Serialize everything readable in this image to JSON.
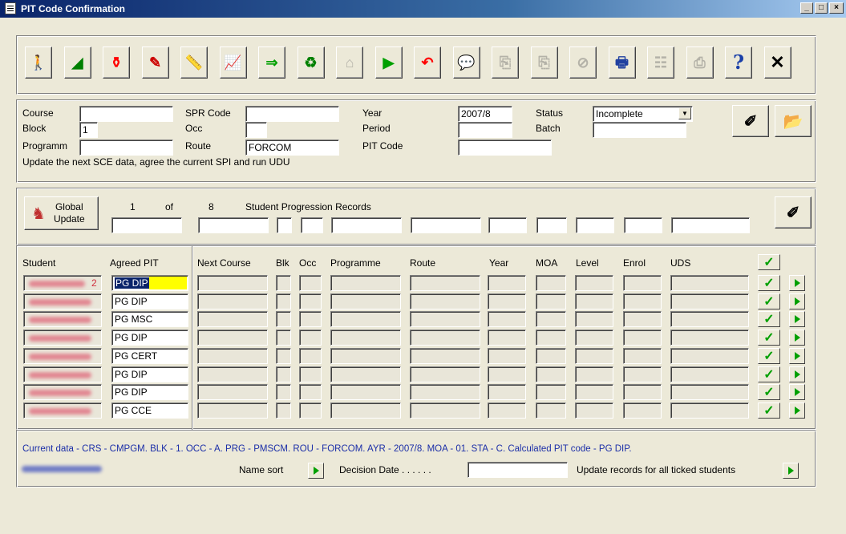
{
  "window": {
    "title": "PIT Code Confirmation",
    "controls": [
      "_",
      "□",
      "×"
    ]
  },
  "toolbar": {
    "buttons": [
      {
        "name": "person-icon",
        "glyph": "🚶",
        "enabled": true
      },
      {
        "name": "eraser-icon",
        "glyph": "◢",
        "enabled": true
      },
      {
        "name": "bottles-icon",
        "glyph": "⚱",
        "enabled": true
      },
      {
        "name": "pencil-icon",
        "glyph": "✎",
        "enabled": true
      },
      {
        "name": "ruler-icon",
        "glyph": "📏",
        "enabled": true
      },
      {
        "name": "presenter-icon",
        "glyph": "📈",
        "enabled": true
      },
      {
        "name": "truck-icon",
        "glyph": "⇒",
        "enabled": true
      },
      {
        "name": "recycle-icon",
        "glyph": "♻",
        "enabled": true
      },
      {
        "name": "puzzle-icon",
        "glyph": "⌂",
        "enabled": false
      },
      {
        "name": "play-icon",
        "glyph": "▶",
        "enabled": true
      },
      {
        "name": "undo-icon",
        "glyph": "↶",
        "enabled": true
      },
      {
        "name": "speech-bubble-icon",
        "glyph": "💬",
        "enabled": true
      },
      {
        "name": "copy-icon",
        "glyph": "⎘",
        "enabled": false
      },
      {
        "name": "copy2-icon",
        "glyph": "⎘",
        "enabled": false
      },
      {
        "name": "no-edit-icon",
        "glyph": "⊘",
        "enabled": false
      },
      {
        "name": "printer-icon",
        "glyph": "🖶",
        "enabled": true
      },
      {
        "name": "stack-icon",
        "glyph": "☷",
        "enabled": false
      },
      {
        "name": "document-icon",
        "glyph": "⎙",
        "enabled": false
      },
      {
        "name": "help-icon",
        "glyph": "?",
        "enabled": true
      },
      {
        "name": "close-icon",
        "glyph": "✕",
        "enabled": true
      }
    ]
  },
  "form": {
    "course_label": "Course",
    "course_value": "",
    "block_label": "Block",
    "block_value": "1",
    "programm_label": "Programm",
    "programm_value": "",
    "spr_label": "SPR Code",
    "spr_value": "",
    "occ_label": "Occ",
    "occ_value": "",
    "route_label": "Route",
    "route_value": "FORCOM",
    "year_label": "Year",
    "year_value": "2007/8",
    "period_label": "Period",
    "period_value": "",
    "pit_label": "PIT Code",
    "pit_value": "",
    "status_label": "Status",
    "status_value": "Incomplete",
    "batch_label": "Batch",
    "batch_value": "",
    "instructions": "Update the next SCE data, agree the current SPI and run UDU"
  },
  "global": {
    "button_line1": "Global",
    "button_line2": "Update",
    "current": "1",
    "of_label": "of",
    "total": "8",
    "records_label": "Student Progression Records"
  },
  "grid": {
    "headers": {
      "student": "Student",
      "agreed_pit": "Agreed PIT",
      "next_course": "Next Course",
      "blk": "Blk",
      "occ": "Occ",
      "programme": "Programme",
      "route": "Route",
      "year": "Year",
      "moa": "MOA",
      "level": "Level",
      "enrol": "Enrol",
      "uds": "UDS"
    },
    "rows": [
      {
        "student_suffix": "2",
        "pit": "PG DIP",
        "selected": true
      },
      {
        "student_suffix": "",
        "pit": "PG DIP",
        "selected": false
      },
      {
        "student_suffix": "",
        "pit": "PG MSC",
        "selected": false
      },
      {
        "student_suffix": "",
        "pit": "PG DIP",
        "selected": false
      },
      {
        "student_suffix": "",
        "pit": "PG CERT",
        "selected": false
      },
      {
        "student_suffix": "",
        "pit": "PG DIP",
        "selected": false
      },
      {
        "student_suffix": "",
        "pit": "PG DIP",
        "selected": false
      },
      {
        "student_suffix": "",
        "pit": "PG CCE",
        "selected": false
      }
    ]
  },
  "footer": {
    "current_data": "Current data - CRS - CMPGM. BLK - 1. OCC - A. PRG - PMSCM. ROU - FORCOM. AYR - 2007/8. MOA - 01. STA - C. Calculated PIT code - PG DIP.",
    "name_sort": "Name sort",
    "decision_date": "Decision Date . . . . . .",
    "decision_value": "",
    "update_all": "Update records for all ticked students"
  },
  "colors": {
    "title_start": "#0a246a",
    "selected_cell": "#ffff00",
    "status_text": "#1c2fa8",
    "check_green": "#00a000"
  }
}
